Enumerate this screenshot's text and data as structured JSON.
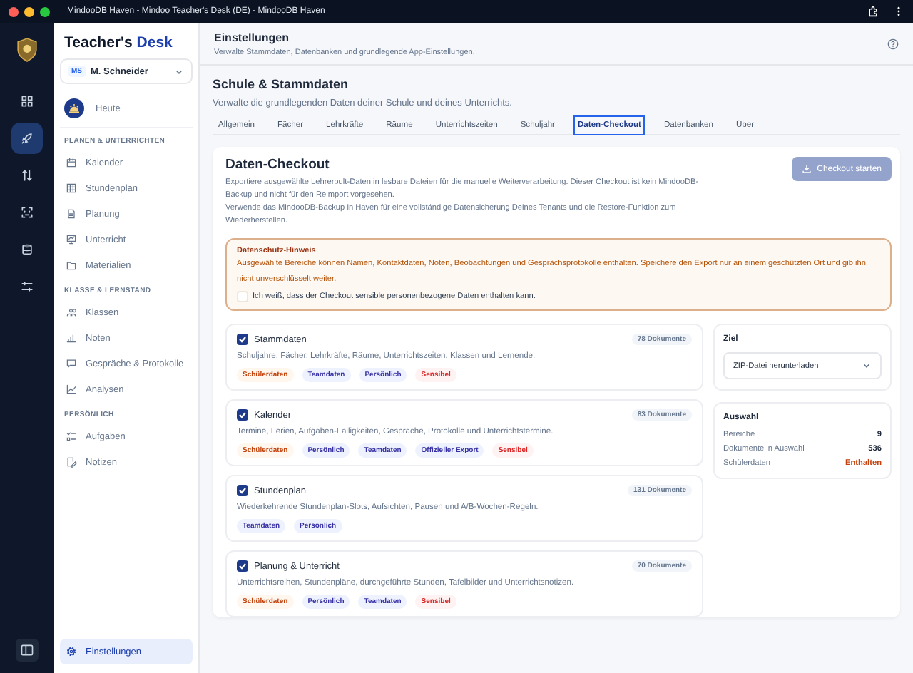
{
  "window": {
    "title": "MindooDB Haven - Mindoo Teacher's Desk (DE) - MindooDB Haven"
  },
  "rail": {
    "items": [
      {
        "selected": false
      },
      {
        "selected": true
      },
      {
        "selected": false
      },
      {
        "selected": false
      },
      {
        "selected": false
      },
      {
        "selected": false
      }
    ]
  },
  "sidebar": {
    "brand": {
      "part_1": "Teacher's",
      "part_2": "Desk"
    },
    "user": {
      "initials": "MS",
      "name": "M. Schneider"
    },
    "today": {
      "label": "Heute"
    },
    "sections": [
      {
        "title": "PLANEN & UNTERRICHTEN",
        "items": [
          {
            "label": "Kalender",
            "selected": false
          },
          {
            "label": "Stundenplan",
            "selected": false
          },
          {
            "label": "Planung",
            "selected": false
          },
          {
            "label": "Unterricht",
            "selected": false
          },
          {
            "label": "Materialien",
            "selected": false
          }
        ]
      },
      {
        "title": "KLASSE & LERNSTAND",
        "items": [
          {
            "label": "Klassen",
            "selected": false
          },
          {
            "label": "Noten",
            "selected": false
          },
          {
            "label": "Gespräche & Protokolle",
            "selected": false
          },
          {
            "label": "Analysen",
            "selected": false
          }
        ]
      },
      {
        "title": "PERSÖNLICH",
        "items": [
          {
            "label": "Aufgaben",
            "selected": false
          },
          {
            "label": "Notizen",
            "selected": false
          }
        ]
      }
    ],
    "footer_item": {
      "label": "Einstellungen",
      "selected": true
    }
  },
  "header": {
    "title": "Einstellungen",
    "subtitle": "Verwalte Stammdaten, Datenbanken und grundlegende App-Einstellungen."
  },
  "section": {
    "title": "Schule & Stammdaten",
    "subtitle": "Verwalte die grundlegenden Daten deiner Schule und deines Unterrichts."
  },
  "tabs": [
    {
      "label": "Allgemein",
      "selected": false
    },
    {
      "label": "Fächer",
      "selected": false
    },
    {
      "label": "Lehrkräfte",
      "selected": false
    },
    {
      "label": "Räume",
      "selected": false
    },
    {
      "label": "Unterrichtszeiten",
      "selected": false
    },
    {
      "label": "Schuljahr",
      "selected": false
    },
    {
      "label": "Daten-Checkout",
      "selected": true
    },
    {
      "label": "Datenbanken",
      "selected": false
    },
    {
      "label": "Über",
      "selected": false
    }
  ],
  "checkout": {
    "title": "Daten-Checkout",
    "paragraphs": [
      "Exportiere ausgewählte Lehrerpult-Daten in lesbare Dateien für die manuelle Weiterverarbeitung. Dieser Checkout ist kein MindooDB-Backup und nicht für den Reimport vorgesehen.",
      "Verwende das MindooDB-Backup in Haven für eine vollständige Datensicherung Deines Tenants und die Restore-Funktion zum Wiederherstellen."
    ],
    "start_button": {
      "label": "Checkout starten",
      "disabled": true
    },
    "notice": {
      "title": "Datenschutz-Hinweis",
      "text": "Ausgewählte Bereiche können Namen, Kontaktdaten, Noten, Beobachtungen und Gesprächsprotokolle enthalten. Speichere den Export nur an einem geschützten Ort und gib ihn nicht unverschlüsselt weiter.",
      "confirm_label": "Ich weiß, dass der Checkout sensible personenbezogene Daten enthalten kann.",
      "checked": false
    },
    "areas": [
      {
        "name": "Stammdaten",
        "count": "78 Dokumente",
        "checked": true,
        "description": "Schuljahre, Fächer, Lehrkräfte, Räume, Unterrichtszeiten, Klassen und Lernende.",
        "tags": [
          {
            "label": "Schülerdaten",
            "kind": "student"
          },
          {
            "label": "Teamdaten",
            "kind": "info"
          },
          {
            "label": "Persönlich",
            "kind": "info"
          },
          {
            "label": "Sensibel",
            "kind": "sensitive"
          }
        ]
      },
      {
        "name": "Kalender",
        "count": "83 Dokumente",
        "checked": true,
        "description": "Termine, Ferien, Aufgaben-Fälligkeiten, Gespräche, Protokolle und Unterrichtstermine.",
        "tags": [
          {
            "label": "Schülerdaten",
            "kind": "student"
          },
          {
            "label": "Persönlich",
            "kind": "info"
          },
          {
            "label": "Teamdaten",
            "kind": "info"
          },
          {
            "label": "Offizieller Export",
            "kind": "info"
          },
          {
            "label": "Sensibel",
            "kind": "sensitive"
          }
        ]
      },
      {
        "name": "Stundenplan",
        "count": "131 Dokumente",
        "checked": true,
        "description": "Wiederkehrende Stundenplan-Slots, Aufsichten, Pausen und A/B-Wochen-Regeln.",
        "tags": [
          {
            "label": "Teamdaten",
            "kind": "info"
          },
          {
            "label": "Persönlich",
            "kind": "info"
          }
        ]
      },
      {
        "name": "Planung & Unterricht",
        "count": "70 Dokumente",
        "checked": true,
        "description": "Unterrichtsreihen, Stundenpläne, durchgeführte Stunden, Tafelbilder und Unterrichtsnotizen.",
        "tags": [
          {
            "label": "Schülerdaten",
            "kind": "student"
          },
          {
            "label": "Persönlich",
            "kind": "info"
          },
          {
            "label": "Teamdaten",
            "kind": "info"
          },
          {
            "label": "Sensibel",
            "kind": "sensitive"
          }
        ]
      }
    ],
    "target": {
      "title": "Ziel",
      "value": "ZIP-Datei herunterladen"
    },
    "summary": {
      "title": "Auswahl",
      "rows": [
        {
          "label": "Bereiche",
          "value": "9",
          "kind": "plain"
        },
        {
          "label": "Dokumente in Auswahl",
          "value": "536",
          "kind": "plain"
        },
        {
          "label": "Schülerdaten",
          "value": "Enthalten",
          "kind": "warning"
        }
      ]
    }
  }
}
